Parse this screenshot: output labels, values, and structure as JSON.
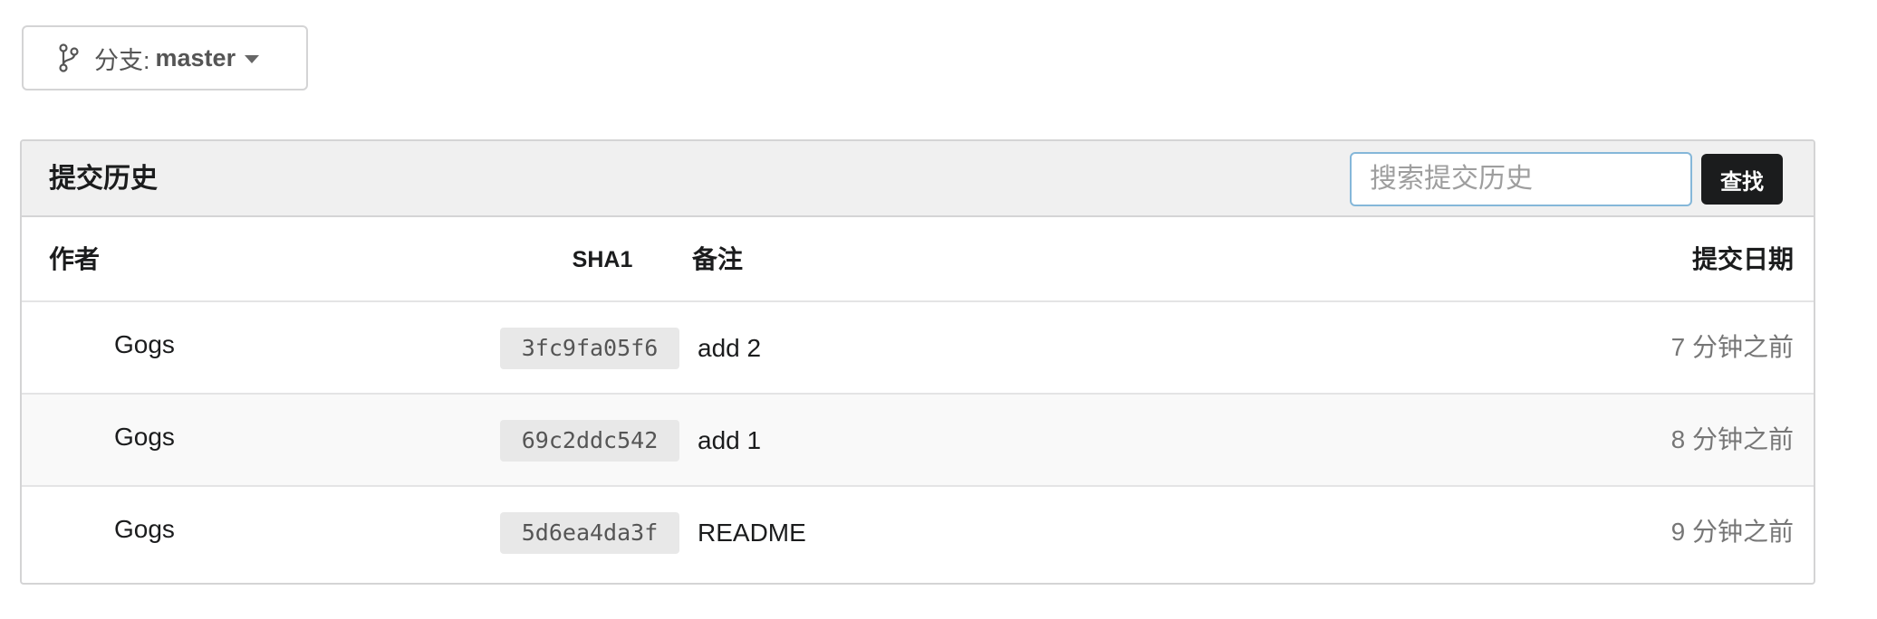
{
  "branch": {
    "prefix": "分支:",
    "name": "master"
  },
  "panel": {
    "title": "提交历史",
    "search": {
      "placeholder": "搜索提交历史",
      "value": "",
      "button_label": "查找"
    }
  },
  "table": {
    "headers": {
      "author": "作者",
      "sha": "SHA1",
      "message": "备注",
      "date": "提交日期"
    },
    "rows": [
      {
        "author": "Gogs",
        "sha": "3fc9fa05f6",
        "message": "add 2",
        "date": "7 分钟之前"
      },
      {
        "author": "Gogs",
        "sha": "69c2ddc542",
        "message": "add 1",
        "date": "8 分钟之前"
      },
      {
        "author": "Gogs",
        "sha": "5d6ea4da3f",
        "message": "README",
        "date": "9 分钟之前"
      }
    ]
  },
  "icons": {
    "branch": "git-branch-icon",
    "caret": "caret-down-icon"
  }
}
